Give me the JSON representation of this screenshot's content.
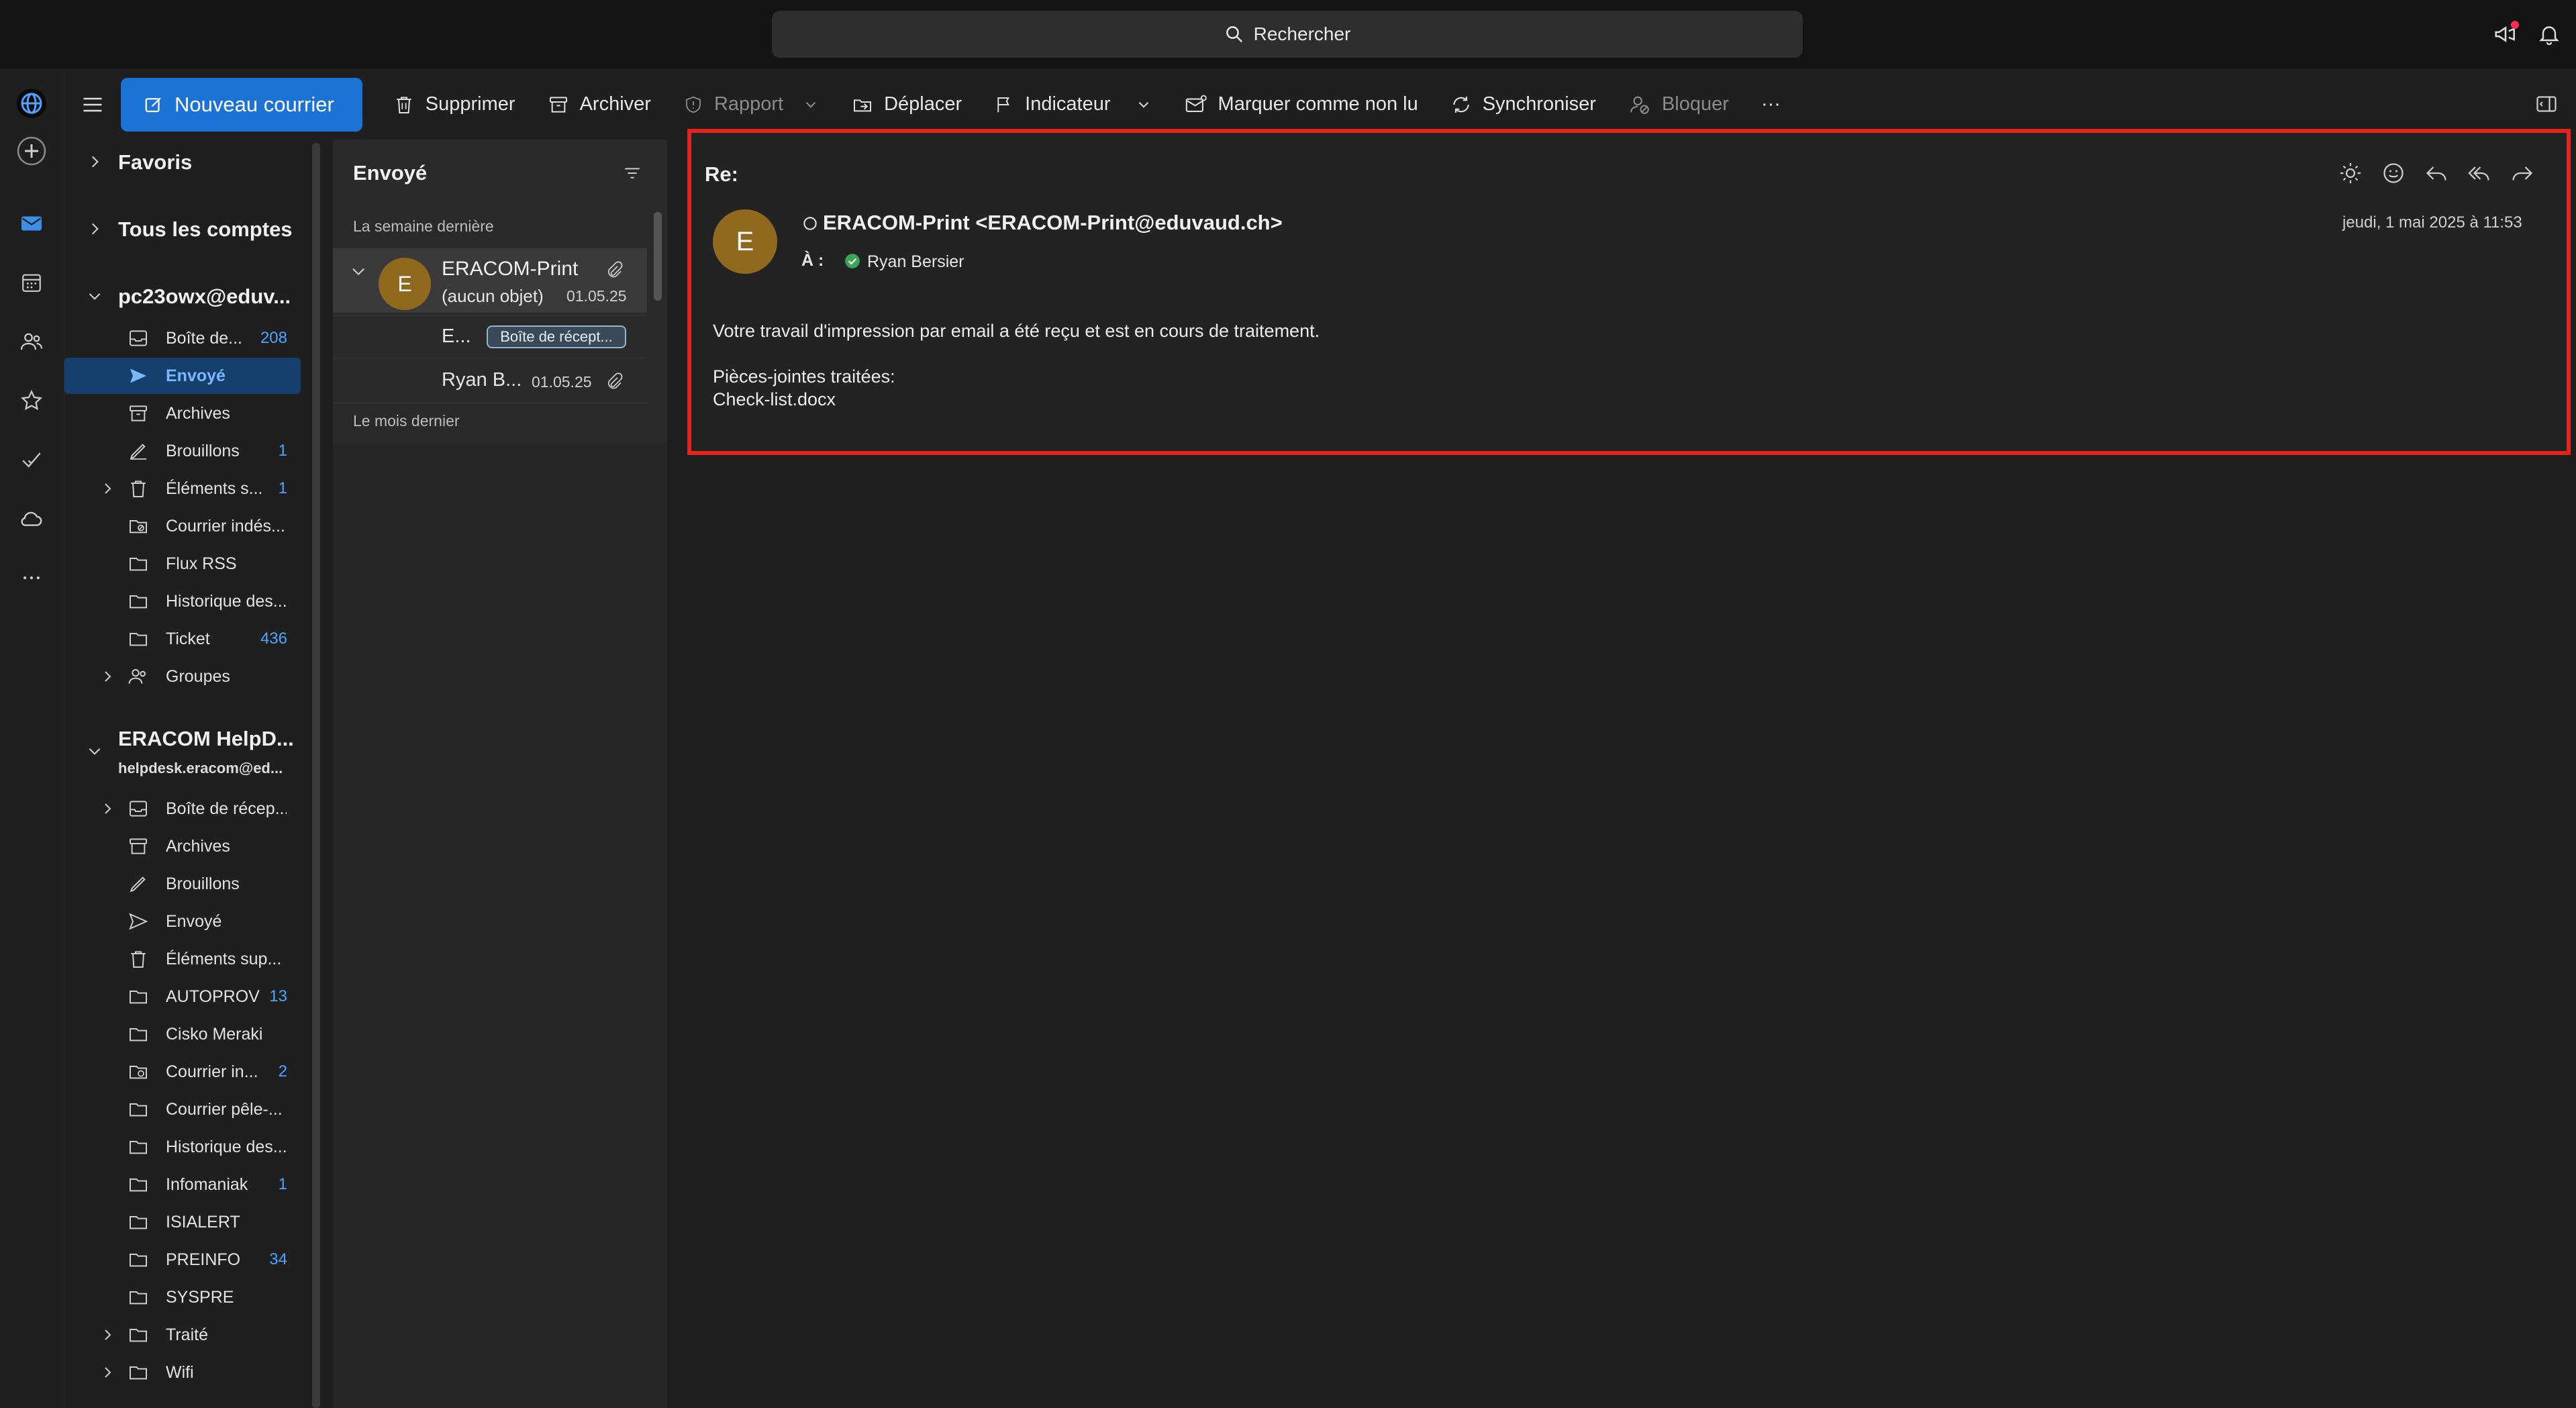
{
  "search": {
    "label": "Rechercher"
  },
  "toolbar": {
    "new_mail": "Nouveau courrier",
    "delete": "Supprimer",
    "archive": "Archiver",
    "report": "Rapport",
    "move": "Déplacer",
    "flag": "Indicateur",
    "mark_unread": "Marquer comme non lu",
    "sync": "Synchroniser",
    "block": "Bloquer",
    "more": "···"
  },
  "folders": {
    "favorites": "Favoris",
    "all_accounts": "Tous les comptes",
    "account1": {
      "name": "pc23owx@eduv...",
      "items": [
        {
          "label": "Boîte de...",
          "count": "208"
        },
        {
          "label": "Envoyé",
          "count": ""
        },
        {
          "label": "Archives",
          "count": ""
        },
        {
          "label": "Brouillons",
          "count": "1"
        },
        {
          "label": "Éléments s...",
          "count": "1"
        },
        {
          "label": "Courrier indés...",
          "count": ""
        },
        {
          "label": "Flux RSS",
          "count": ""
        },
        {
          "label": "Historique des...",
          "count": ""
        },
        {
          "label": "Ticket",
          "count": "436"
        },
        {
          "label": "Groupes",
          "count": ""
        }
      ]
    },
    "account2": {
      "name": "ERACOM HelpD...",
      "email": "helpdesk.eracom@ed...",
      "items": [
        {
          "label": "Boîte de récep...",
          "count": ""
        },
        {
          "label": "Archives",
          "count": ""
        },
        {
          "label": "Brouillons",
          "count": ""
        },
        {
          "label": "Envoyé",
          "count": ""
        },
        {
          "label": "Éléments sup...",
          "count": ""
        },
        {
          "label": "AUTOPROV",
          "count": "13"
        },
        {
          "label": "Cisko Meraki",
          "count": ""
        },
        {
          "label": "Courrier in...",
          "count": "2"
        },
        {
          "label": "Courrier pêle-...",
          "count": ""
        },
        {
          "label": "Historique des...",
          "count": ""
        },
        {
          "label": "Infomaniak",
          "count": "1"
        },
        {
          "label": "ISIALERT",
          "count": ""
        },
        {
          "label": "PREINFO",
          "count": "34"
        },
        {
          "label": "SYSPRE",
          "count": ""
        },
        {
          "label": "Traité",
          "count": ""
        },
        {
          "label": "Wifi",
          "count": ""
        }
      ]
    }
  },
  "message_list": {
    "title": "Envoyé",
    "group_last_week": "La semaine dernière",
    "group_last_month": "Le mois dernier",
    "thread": {
      "avatar": "E",
      "sender": "ERACOM-Print",
      "subject": "(aucun objet)",
      "date": "01.05.25"
    },
    "child1": {
      "sender": "E...",
      "tag": "Boîte de récept..."
    },
    "child2": {
      "sender": "Ryan B...",
      "date": "01.05.25"
    }
  },
  "reading": {
    "subject": "Re:",
    "avatar": "E",
    "from": "ERACOM-Print <ERACOM-Print@eduvaud.ch>",
    "to_label": "À :",
    "to": "Ryan Bersier",
    "date": "jeudi, 1 mai 2025 à 11:53",
    "body_line1": "Votre travail d'impression par email a été reçu et est en cours de traitement.",
    "body_line2": "Pièces-jointes traitées:",
    "body_line3": "Check-list.docx"
  },
  "colors": {
    "accent": "#1b73d6",
    "highlight_border": "#e3231c",
    "avatar": "#8f6a1e"
  }
}
